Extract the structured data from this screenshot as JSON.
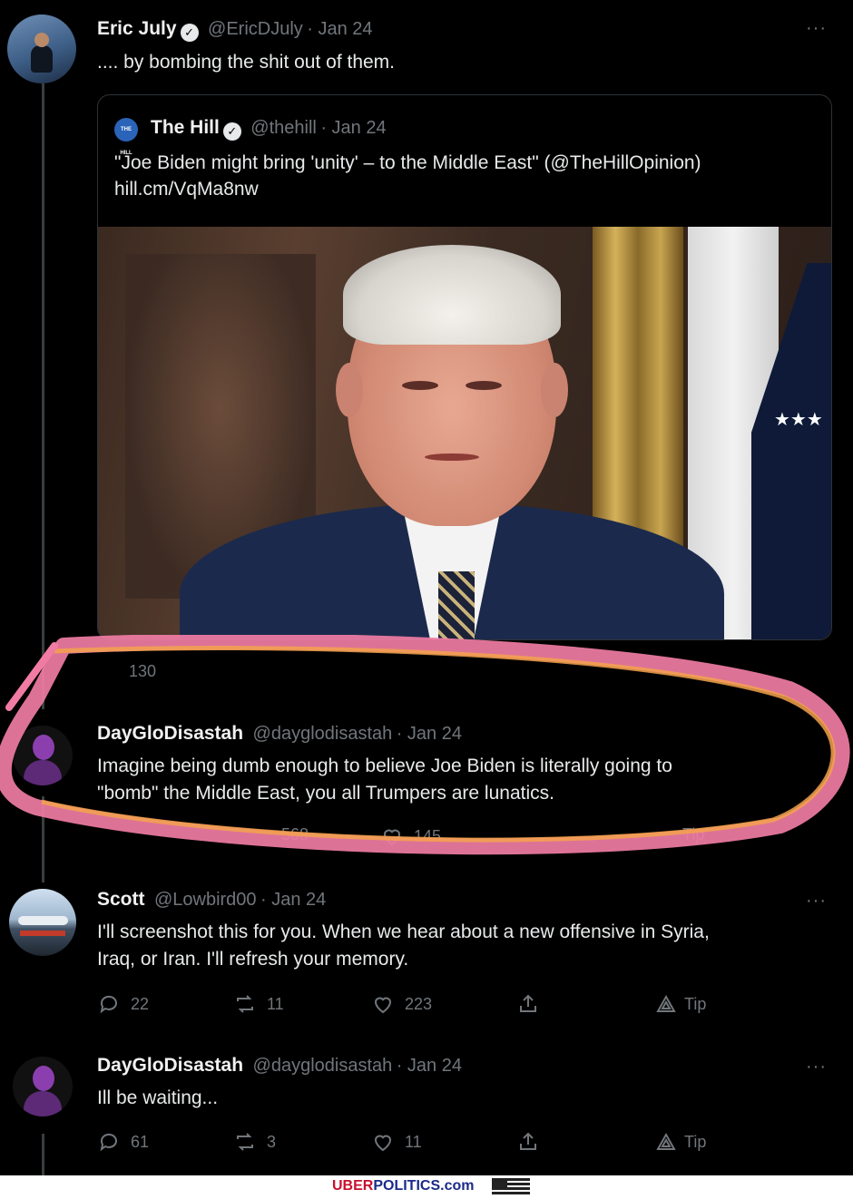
{
  "tweet1": {
    "name": "Eric July",
    "handle": "@EricDJuly",
    "date": "Jan 24",
    "text": ".... by bombing the shit out of them.",
    "more": "···"
  },
  "quote": {
    "logo": "THE HILL",
    "name": "The Hill",
    "handle": "@thehill",
    "date": "Jan 24",
    "text": "\"Joe Biden might bring 'unity' – to the Middle East\" (@TheHillOpinion)",
    "link": "hill.cm/VqMa8nw"
  },
  "tweet1_actions": {
    "reply": "130"
  },
  "tweet2": {
    "name": "DayGloDisastah",
    "handle": "@dayglodisastah",
    "date": "Jan 24",
    "text_line1": "Imagine being dumb enough to believe Joe Biden is literally going to",
    "text_line2": "\"bomb\" the Middle East, you all Trumpers are lunatics.",
    "retweets": "568",
    "likes": "145",
    "tip": "Tip"
  },
  "tweet3": {
    "name": "Scott",
    "handle": "@Lowbird00",
    "date": "Jan 24",
    "text_line1": "I'll screenshot this for you. When we hear about a new offensive in Syria,",
    "text_line2": "Iraq, or Iran. I'll refresh your memory.",
    "replies": "22",
    "retweets": "11",
    "likes": "223",
    "tip": "Tip",
    "more": "···"
  },
  "tweet4": {
    "name": "DayGloDisastah",
    "handle": "@dayglodisastah",
    "date": "Jan 24",
    "text": "Ill be waiting...",
    "replies": "61",
    "retweets": "3",
    "likes": "11",
    "tip": "Tip",
    "more": "···"
  },
  "footer": {
    "uber": "UBER",
    "politics": "POLITICS.com"
  },
  "colors": {
    "highlight_pink": "#f07ca4",
    "highlight_orange": "#f4a24c",
    "footer_red": "#c8102e",
    "footer_blue": "#1b2a8a"
  }
}
